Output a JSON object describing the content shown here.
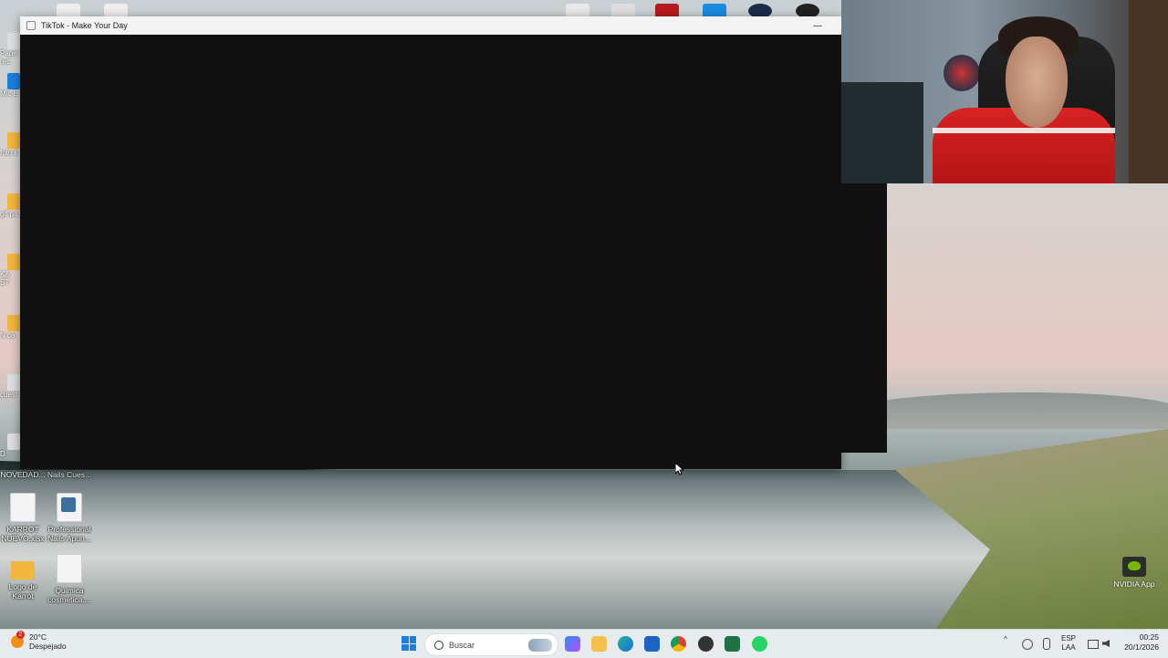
{
  "window": {
    "title": "TikTok - Make Your Day",
    "minimize_glyph": "—"
  },
  "desktop_icons": {
    "novedad": "NOVEDAD...",
    "nails_cues": "Nails Cues...",
    "karrot_nuevo": "KARROT NUEVO.xlsx",
    "professional_nails": "Professional Nails Apun...",
    "logo_karrot": "Logo de Karrot",
    "quimica": "Quimica cosmetica...."
  },
  "left_strip": [
    "Pape rec",
    "Mic E",
    "foto k",
    "gif pa",
    "KA ST",
    "N ca",
    "cuest",
    "D"
  ],
  "nvidia": {
    "label": "NVIDIA App"
  },
  "taskbar": {
    "weather_temp": "20°C",
    "weather_desc": "Despejado",
    "weather_badge": "2",
    "search_placeholder": "Buscar",
    "lang_top": "ESP",
    "lang_bottom": "LAA",
    "time": "00:25",
    "date": "20/1/2026",
    "tray_up": "^"
  },
  "colors": {
    "taskbar_bg": "#e6ebee",
    "start_blue": "#1a7fe0",
    "window_bg": "#111111"
  },
  "icons": {
    "taskbar_apps": [
      "start-icon",
      "search-icon",
      "copilot-icon",
      "file-explorer-icon",
      "edge-icon",
      "store-icon",
      "chrome-icon",
      "obs-icon",
      "excel-icon",
      "whatsapp-icon"
    ]
  }
}
